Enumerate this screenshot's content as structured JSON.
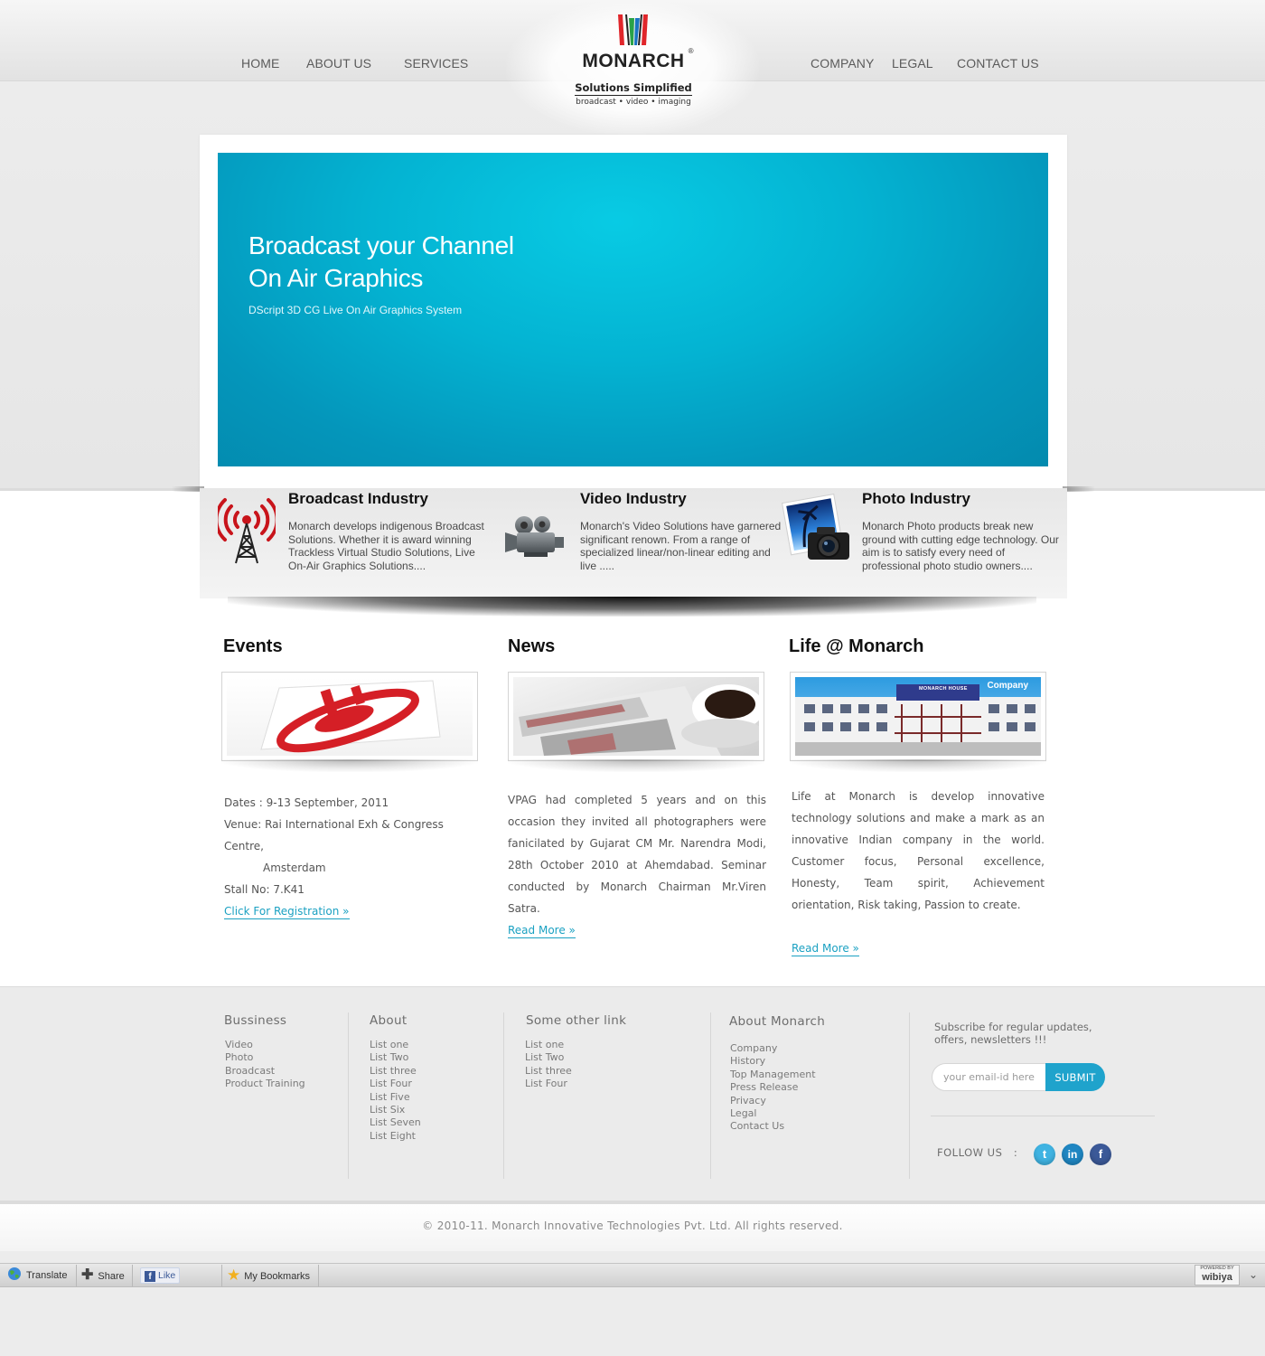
{
  "nav": {
    "left": [
      "HOME",
      "ABOUT US",
      "SERVICES"
    ],
    "right": [
      "COMPANY",
      "LEGAL",
      "CONTACT US"
    ]
  },
  "logo": {
    "name": "MONARCH",
    "registered": "®",
    "tagline": "Solutions Simplified",
    "subline": "broadcast • video • imaging"
  },
  "hero": {
    "title_line1": "Broadcast your Channel",
    "title_line2": "On Air Graphics",
    "subtitle": "DScript 3D CG Live On Air Graphics System"
  },
  "industries": [
    {
      "title": "Broadcast Industry",
      "text": "Monarch develops indigenous Broadcast Solutions. Whether it is award winning Trackless Virtual Studio Solutions, Live On-Air Graphics Solutions....",
      "icon": "broadcast-tower-icon"
    },
    {
      "title": "Video Industry",
      "text": "Monarch's Video Solutions have garnered significant renown. From a range of specialized linear/non-linear editing and live .....",
      "icon": "video-camera-icon"
    },
    {
      "title": "Photo Industry",
      "text": "Monarch Photo products break new ground with cutting edge technology. Our aim is to satisfy every need of professional photo studio owners....",
      "icon": "photo-camera-icon"
    }
  ],
  "events": {
    "title": "Events",
    "dates": "Dates : 9-13 September, 2011",
    "venue_line1": "Venue: Rai International Exh & Congress Centre,",
    "venue_line2": "Amsterdam",
    "stall": "Stall No: 7.K41",
    "link": "Click For Registration »"
  },
  "news": {
    "title": "News",
    "text": "VPAG had completed 5 years and on this occasion they invited all photographers were fanicilated by Gujarat CM Mr. Narendra Modi, 28th October 2010 at Ahemdabad. Seminar conducted by Monarch Chairman Mr.Viren Satra.",
    "link": "Read More »"
  },
  "life": {
    "title": "Life @ Monarch",
    "image_caption": "Company",
    "building_sign": "MONARCH HOUSE",
    "text": "Life at Monarch is develop innovative technology solutions and make a mark as an innovative Indian company in the world. Customer focus, Personal excellence, Honesty, Team spirit, Achievement orientation, Risk taking, Passion to create.",
    "link": "Read More »"
  },
  "footer": {
    "business": {
      "title": "Bussiness",
      "items": [
        "Video",
        "Photo",
        "Broadcast",
        "Product Training"
      ]
    },
    "about": {
      "title": "About",
      "items": [
        "List one",
        "List Two",
        "List three",
        "List Four",
        "List Five",
        "List Six",
        "List Seven",
        "List Eight"
      ]
    },
    "other": {
      "title": "Some other link",
      "items": [
        "List one",
        "List Two",
        "List three",
        "List Four"
      ]
    },
    "about_monarch": {
      "title": "About Monarch",
      "items": [
        "Company",
        "History",
        "Top Management",
        "Press Release",
        "Privacy",
        "Legal",
        "Contact Us"
      ]
    },
    "subscribe": {
      "text": "Subscribe for regular updates, offers, newsletters !!!",
      "placeholder": "your email-id here",
      "button": "SUBMIT"
    },
    "follow": "FOLLOW US   :",
    "social": [
      "twitter-icon",
      "linkedin-icon",
      "facebook-icon"
    ],
    "social_colors": {
      "twitter": "#3fb3e2",
      "linkedin": "#1f86c2",
      "facebook": "#3b5998"
    }
  },
  "copyright": "© 2010-11. Monarch Innovative Technologies Pvt. Ltd. All rights reserved.",
  "toolbar": {
    "translate": "Translate",
    "share": "Share",
    "like": "Like",
    "bookmarks": "My Bookmarks",
    "powered_small": "POWERED BY",
    "powered_brand": "wibiya"
  },
  "colors": {
    "hero": "#04b3d2",
    "accent": "#1ba1c2",
    "logo_red": "#e0262b",
    "logo_green": "#2aa248",
    "logo_blue": "#1a75c2"
  }
}
